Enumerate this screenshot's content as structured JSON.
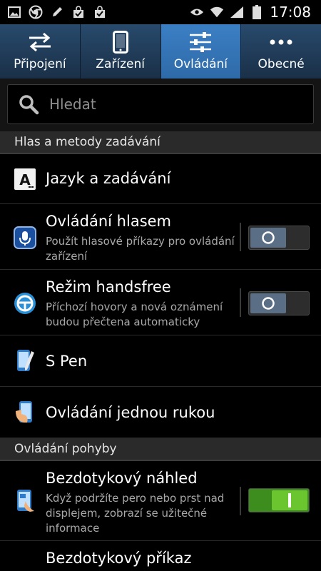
{
  "status_bar": {
    "time": "17:08",
    "left_icons": [
      "gallery-icon",
      "chrome-icon",
      "pen-icon",
      "bag-check-icon",
      "bag-check-icon"
    ],
    "right_icons": [
      "eye-icon",
      "wifi-icon",
      "signal-icon",
      "battery-icon"
    ]
  },
  "tabs": [
    {
      "label": "Připojení",
      "icon": "arrows-swap-icon",
      "active": false
    },
    {
      "label": "Zařízení",
      "icon": "phone-icon",
      "active": false
    },
    {
      "label": "Ovládání",
      "icon": "sliders-icon",
      "active": true
    },
    {
      "label": "Obecné",
      "icon": "more-dots-icon",
      "active": false
    }
  ],
  "search": {
    "placeholder": "Hledat"
  },
  "sections": [
    {
      "title": "Hlas a metody zadávání"
    },
    {
      "title": "Ovládání pohyby"
    }
  ],
  "items": [
    {
      "title": "Jazyk a zadávání",
      "icon": "keyboard-a-icon"
    },
    {
      "title": "Ovládání hlasem",
      "subtitle": "Použít hlasové příkazy pro ovládání zařízení",
      "icon": "microphone-icon",
      "toggle": "off"
    },
    {
      "title": "Režim handsfree",
      "subtitle": "Příchozí hovory a nová oznámení budou přečtena automaticky",
      "icon": "steering-wheel-icon",
      "toggle": "off"
    },
    {
      "title": "S Pen",
      "icon": "s-pen-icon"
    },
    {
      "title": "Ovládání jednou rukou",
      "icon": "one-hand-icon"
    },
    {
      "title": "Bezdotykový náhled",
      "subtitle": "Když podržíte pero nebo prst nad displejem, zobrazí se užitečné informace",
      "icon": "air-view-icon",
      "toggle": "on"
    },
    {
      "title": "Bezdotykový příkaz",
      "icon": "air-command-icon"
    }
  ],
  "colors": {
    "active_tab": "#3b7fc4",
    "tab": "#284a6c",
    "toggle_on": "#6ac52e",
    "toggle_off": "#5a6f85"
  }
}
